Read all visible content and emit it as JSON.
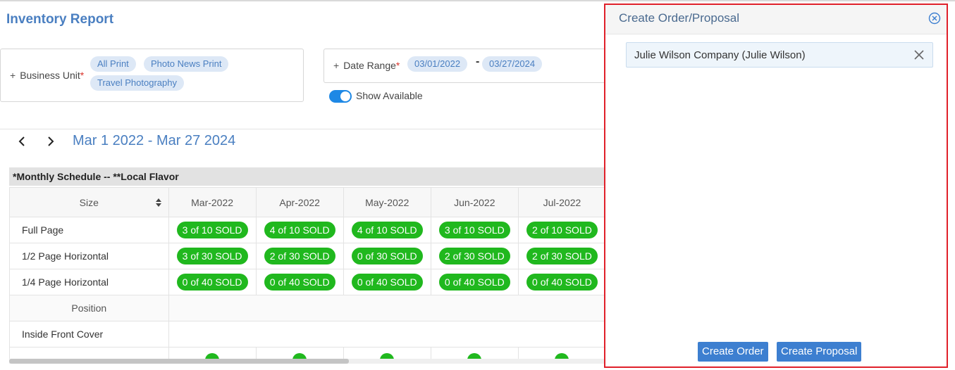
{
  "page_title": "Inventory Report",
  "filters": {
    "business_unit": {
      "label": "Business Unit",
      "required_mark": "*",
      "plus": "+",
      "chips": [
        "All Print",
        "Photo News Print",
        "Travel Photography"
      ]
    },
    "date_range": {
      "label": "Date Range",
      "required_mark": "*",
      "plus": "+",
      "start": "03/01/2022",
      "separator": "-",
      "end": "03/27/2024"
    },
    "show_available": {
      "label": "Show Available",
      "on": true
    }
  },
  "range_title": "Mar 1 2022 - Mar 27 2024",
  "schedule": {
    "section_title": "*Monthly Schedule -- **Local Flavor",
    "size_header": "Size",
    "months": [
      "Mar-2022",
      "Apr-2022",
      "May-2022",
      "Jun-2022",
      "Jul-2022"
    ],
    "size_rows": [
      {
        "label": "Full Page",
        "cells": [
          "3 of 10 SOLD",
          "4 of 10 SOLD",
          "4 of 10 SOLD",
          "3 of 10 SOLD",
          "2 of 10 SOLD"
        ]
      },
      {
        "label": "1/2 Page Horizontal",
        "cells": [
          "3 of 30 SOLD",
          "2 of 30 SOLD",
          "0 of 30 SOLD",
          "2 of 30 SOLD",
          "2 of 30 SOLD"
        ]
      },
      {
        "label": "1/4 Page Horizontal",
        "cells": [
          "0 of 40 SOLD",
          "0 of 40 SOLD",
          "0 of 40 SOLD",
          "0 of 40 SOLD",
          "0 of 40 SOLD"
        ]
      }
    ],
    "position_header": "Position",
    "position_rows": [
      {
        "label": "Inside Front Cover"
      }
    ]
  },
  "panel": {
    "title": "Create Order/Proposal",
    "customer": "Julie Wilson Company (Julie Wilson)",
    "create_order_label": "Create Order",
    "create_proposal_label": "Create Proposal"
  },
  "colors": {
    "accent": "#4a7fc1",
    "sold_badge": "#20b81e",
    "panel_border": "#e0202a",
    "button": "#3d7fd0"
  }
}
